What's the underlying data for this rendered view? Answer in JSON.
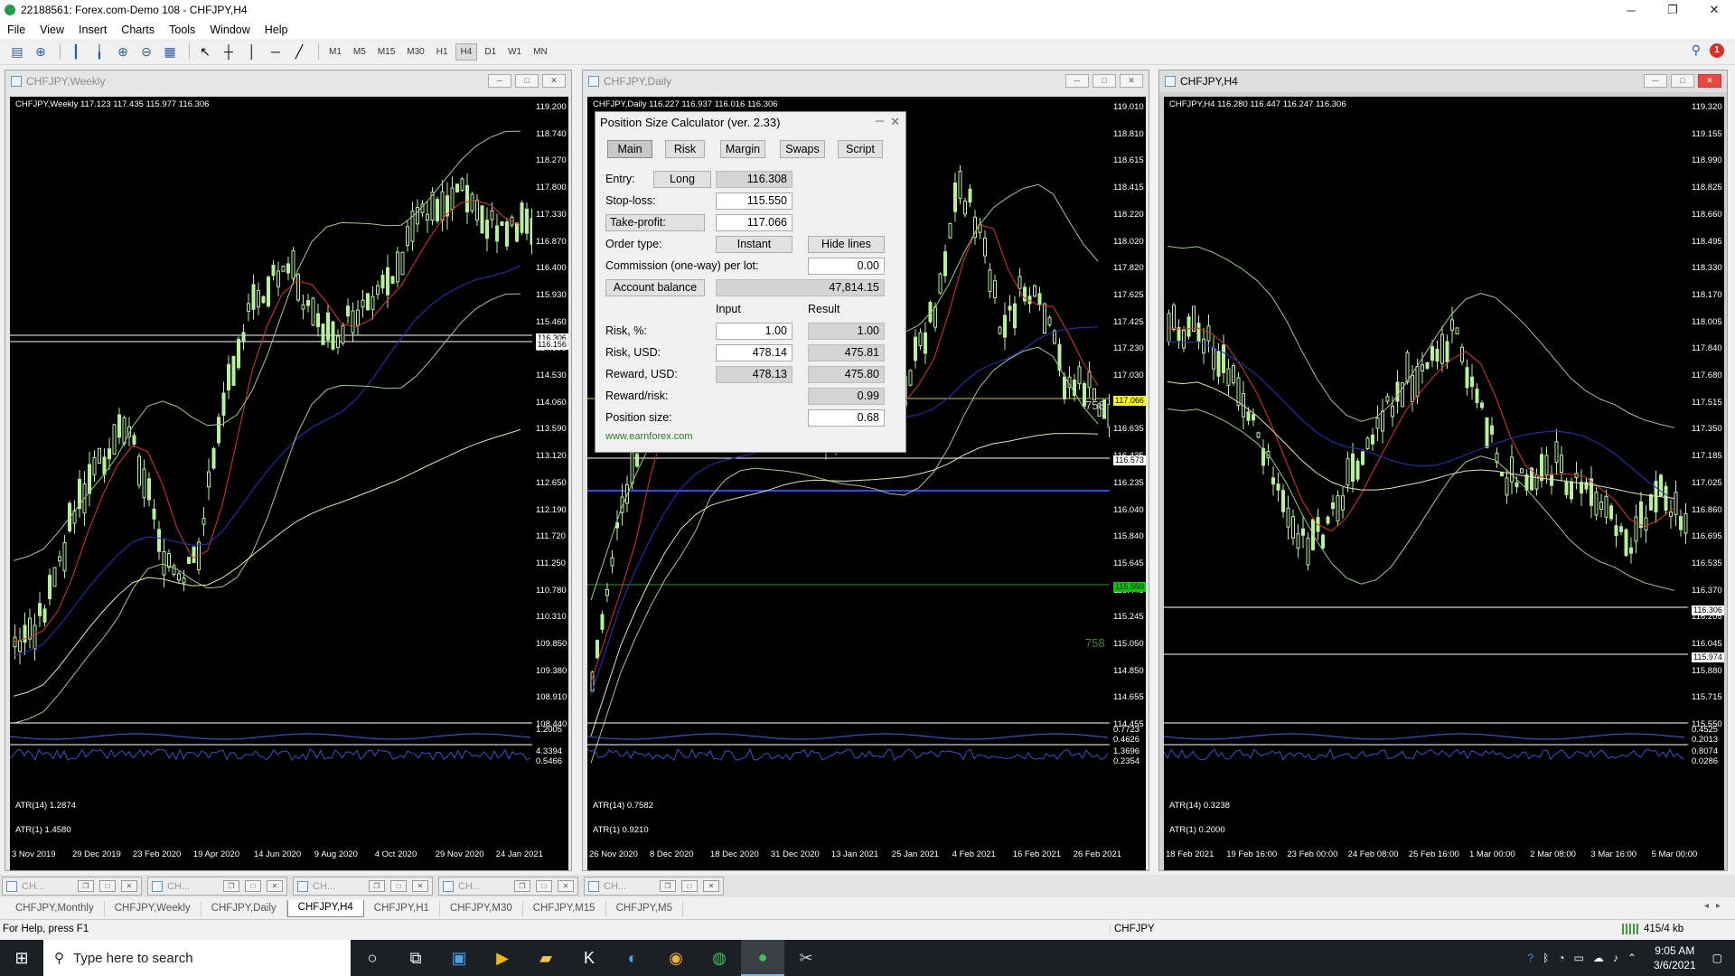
{
  "window": {
    "title": "22188561: Forex.com-Demo 108 - CHFJPY,H4",
    "min": "─",
    "max": "❐",
    "close": "✕"
  },
  "menu": [
    "File",
    "View",
    "Insert",
    "Charts",
    "Tools",
    "Window",
    "Help"
  ],
  "timeframes": [
    "M1",
    "M5",
    "M15",
    "M30",
    "H1",
    "H4",
    "D1",
    "W1",
    "MN"
  ],
  "active_timeframe": "H4",
  "notification_count": "1",
  "charts": {
    "weekly": {
      "title": "CHFJPY,Weekly",
      "ohlc": "CHFJPY,Weekly  117.123 117.435 115.977 116.306",
      "prices": [
        "119.200",
        "118.740",
        "118.270",
        "117.800",
        "117.330",
        "116.870",
        "116.400",
        "115.930",
        "115.460",
        "114.990",
        "114.530",
        "114.060",
        "113.590",
        "113.120",
        "112.650",
        "112.190",
        "111.720",
        "111.250",
        "110.780",
        "110.310",
        "109.850",
        "109.380",
        "108.910",
        "108.440"
      ],
      "tags": [
        {
          "text": "116.306",
          "bg": "#ffffff",
          "fg": "#000000"
        },
        {
          "text": "116.156",
          "bg": "#ffffff",
          "fg": "#000000"
        }
      ],
      "atr14": "ATR(14) 1.2874",
      "atr14_scale": [
        "1.2005"
      ],
      "atr1": "ATR(1) 1.4580",
      "atr1_scale": [
        "4.3394",
        "0.5466"
      ],
      "dates": [
        "3 Nov 2019",
        "29 Dec 2019",
        "23 Feb 2020",
        "19 Apr 2020",
        "14 Jun 2020",
        "9 Aug 2020",
        "4 Oct 2020",
        "29 Nov 2020",
        "24 Jan 2021"
      ]
    },
    "daily": {
      "title": "CHFJPY,Daily",
      "ohlc": "CHFJPY,Daily  116.227 116.937 116.016 116.306",
      "prices": [
        "119.010",
        "118.810",
        "118.615",
        "118.415",
        "118.220",
        "118.020",
        "117.820",
        "117.625",
        "117.425",
        "117.230",
        "117.030",
        "116.830",
        "116.635",
        "116.435",
        "116.235",
        "116.040",
        "115.840",
        "115.645",
        "115.445",
        "115.245",
        "115.050",
        "114.850",
        "114.655",
        "114.455"
      ],
      "tags": [
        {
          "text": "117.066",
          "bg": "#ffff00",
          "fg": "#000000"
        },
        {
          "text": "116.573",
          "bg": "#ffffff",
          "fg": "#000000"
        },
        {
          "text": "115.550",
          "bg": "#00cc00",
          "fg": "#000000"
        }
      ],
      "line_label": "758",
      "atr14": "ATR(14) 0.7582",
      "atr14_scale": [
        "0.7723",
        "0.4626"
      ],
      "atr1": "ATR(1) 0.9210",
      "atr1_scale": [
        "1.3696",
        "0.2354"
      ],
      "dates": [
        "26 Nov 2020",
        "8 Dec 2020",
        "18 Dec 2020",
        "31 Dec 2020",
        "13 Jan 2021",
        "25 Jan 2021",
        "4 Feb 2021",
        "16 Feb 2021",
        "26 Feb 2021"
      ]
    },
    "h4": {
      "title": "CHFJPY,H4",
      "ohlc": "CHFJPY,H4  116.280 116.447 116.247 116.306",
      "prices": [
        "119.320",
        "119.155",
        "118.990",
        "118.825",
        "118.660",
        "118.495",
        "118.330",
        "118.170",
        "118.005",
        "117.840",
        "117.680",
        "117.515",
        "117.350",
        "117.185",
        "117.025",
        "116.860",
        "116.695",
        "116.535",
        "116.370",
        "116.205",
        "116.045",
        "115.880",
        "115.715",
        "115.550"
      ],
      "tags": [
        {
          "text": "116.306",
          "bg": "#ffffff",
          "fg": "#000000"
        },
        {
          "text": "115.974",
          "bg": "#ffffff",
          "fg": "#000000"
        }
      ],
      "atr14": "ATR(14) 0.3238",
      "atr14_scale": [
        "0.4525",
        "0.2013"
      ],
      "atr1": "ATR(1) 0.2000",
      "atr1_scale": [
        "0.8074",
        "0.0286"
      ],
      "dates": [
        "18 Feb 2021",
        "19 Feb 16:00",
        "23 Feb 00:00",
        "24 Feb 08:00",
        "25 Feb 16:00",
        "1 Mar 00:00",
        "2 Mar 08:00",
        "3 Mar 16:00",
        "5 Mar 00:00"
      ]
    }
  },
  "psc": {
    "title": "Position Size Calculator (ver. 2.33)",
    "tabs": [
      "Main",
      "Risk",
      "Margin",
      "Swaps",
      "Script"
    ],
    "entry_label": "Entry:",
    "direction": "Long",
    "entry": "116.308",
    "stoploss_label": "Stop-loss:",
    "stoploss": "115.550",
    "takeprofit_label": "Take-profit:",
    "takeprofit": "117.066",
    "ordertype_label": "Order type:",
    "ordertype": "Instant",
    "hidelines": "Hide lines",
    "commission_label": "Commission (one-way) per lot:",
    "commission": "0.00",
    "account_balance_label": "Account balance",
    "account_balance": "47,814.15",
    "input_header": "Input",
    "result_header": "Result",
    "risk_pct_label": "Risk, %:",
    "risk_pct_input": "1.00",
    "risk_pct_result": "1.00",
    "risk_usd_label": "Risk, USD:",
    "risk_usd_input": "478.14",
    "risk_usd_result": "475.81",
    "reward_usd_label": "Reward, USD:",
    "reward_usd_input": "478.13",
    "reward_usd_result": "475.80",
    "rr_label": "Reward/risk:",
    "rr_result": "0.99",
    "possize_label": "Position size:",
    "possize": "0.68",
    "link": "www.earnforex.com"
  },
  "mdi_items": [
    "CH...",
    "CH...",
    "CH...",
    "CH...",
    "CH..."
  ],
  "chart_tabs": [
    "CHFJPY,Monthly",
    "CHFJPY,Weekly",
    "CHFJPY,Daily",
    "CHFJPY,H4",
    "CHFJPY,H1",
    "CHFJPY,M30",
    "CHFJPY,M15",
    "CHFJPY,M5"
  ],
  "active_tab": "CHFJPY,H4",
  "status": {
    "help": "For Help, press F1",
    "symbol": "CHFJPY",
    "traffic": "415/4 kb"
  },
  "taskbar": {
    "search_placeholder": "Type here to search",
    "time": "9:05 AM",
    "date": "3/6/2021"
  }
}
